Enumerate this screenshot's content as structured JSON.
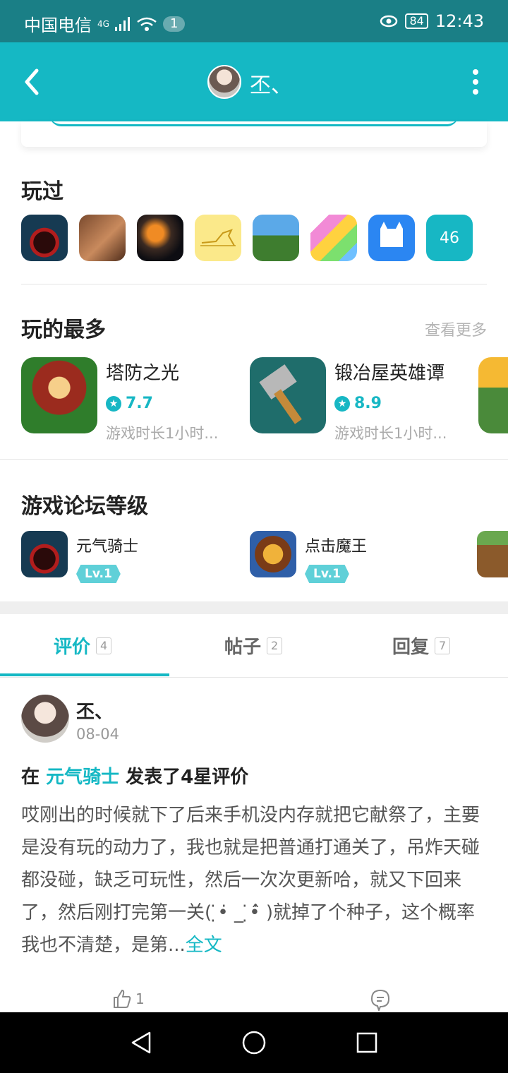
{
  "status_bar": {
    "carrier": "中国电信",
    "network": "4G",
    "notification_count": "1",
    "battery": "84",
    "time": "12:43"
  },
  "header": {
    "title": "丕、"
  },
  "played": {
    "title": "玩过",
    "more_count": "46"
  },
  "most_played": {
    "title": "玩的最多",
    "see_more": "查看更多",
    "items": [
      {
        "name": "塔防之光",
        "rating": "7.7",
        "playtime": "游戏时长1小时..."
      },
      {
        "name": "锻冶屋英雄谭",
        "rating": "8.9",
        "playtime": "游戏时长1小时..."
      }
    ]
  },
  "forum_level": {
    "title": "游戏论坛等级",
    "items": [
      {
        "name": "元气骑士",
        "level": "Lv.1"
      },
      {
        "name": "点击魔王",
        "level": "Lv.1"
      }
    ]
  },
  "tabs": [
    {
      "label": "评价",
      "count": "4"
    },
    {
      "label": "帖子",
      "count": "2"
    },
    {
      "label": "回复",
      "count": "7"
    }
  ],
  "post": {
    "user": "丕、",
    "date": "08-04",
    "prefix": "在",
    "game": "元气骑士",
    "suffix": "发表了4星评价",
    "body": "哎刚出的时候就下了后来手机没内存就把它献祭了，主要是没有玩的动力了，我也就是把普通打通关了，吊炸天碰都没碰，缺乏可玩性，然后一次次更新哈，就又下回来了，然后刚打完第一关( ̣̇•̇ _ ̣̇•̇̂ )就掉了个种子，这个概率我也不清楚，是第...",
    "full_text": "全文",
    "likes": "1"
  },
  "colors": {
    "accent": "#15b8c4",
    "status_bar": "#1a7f86"
  }
}
